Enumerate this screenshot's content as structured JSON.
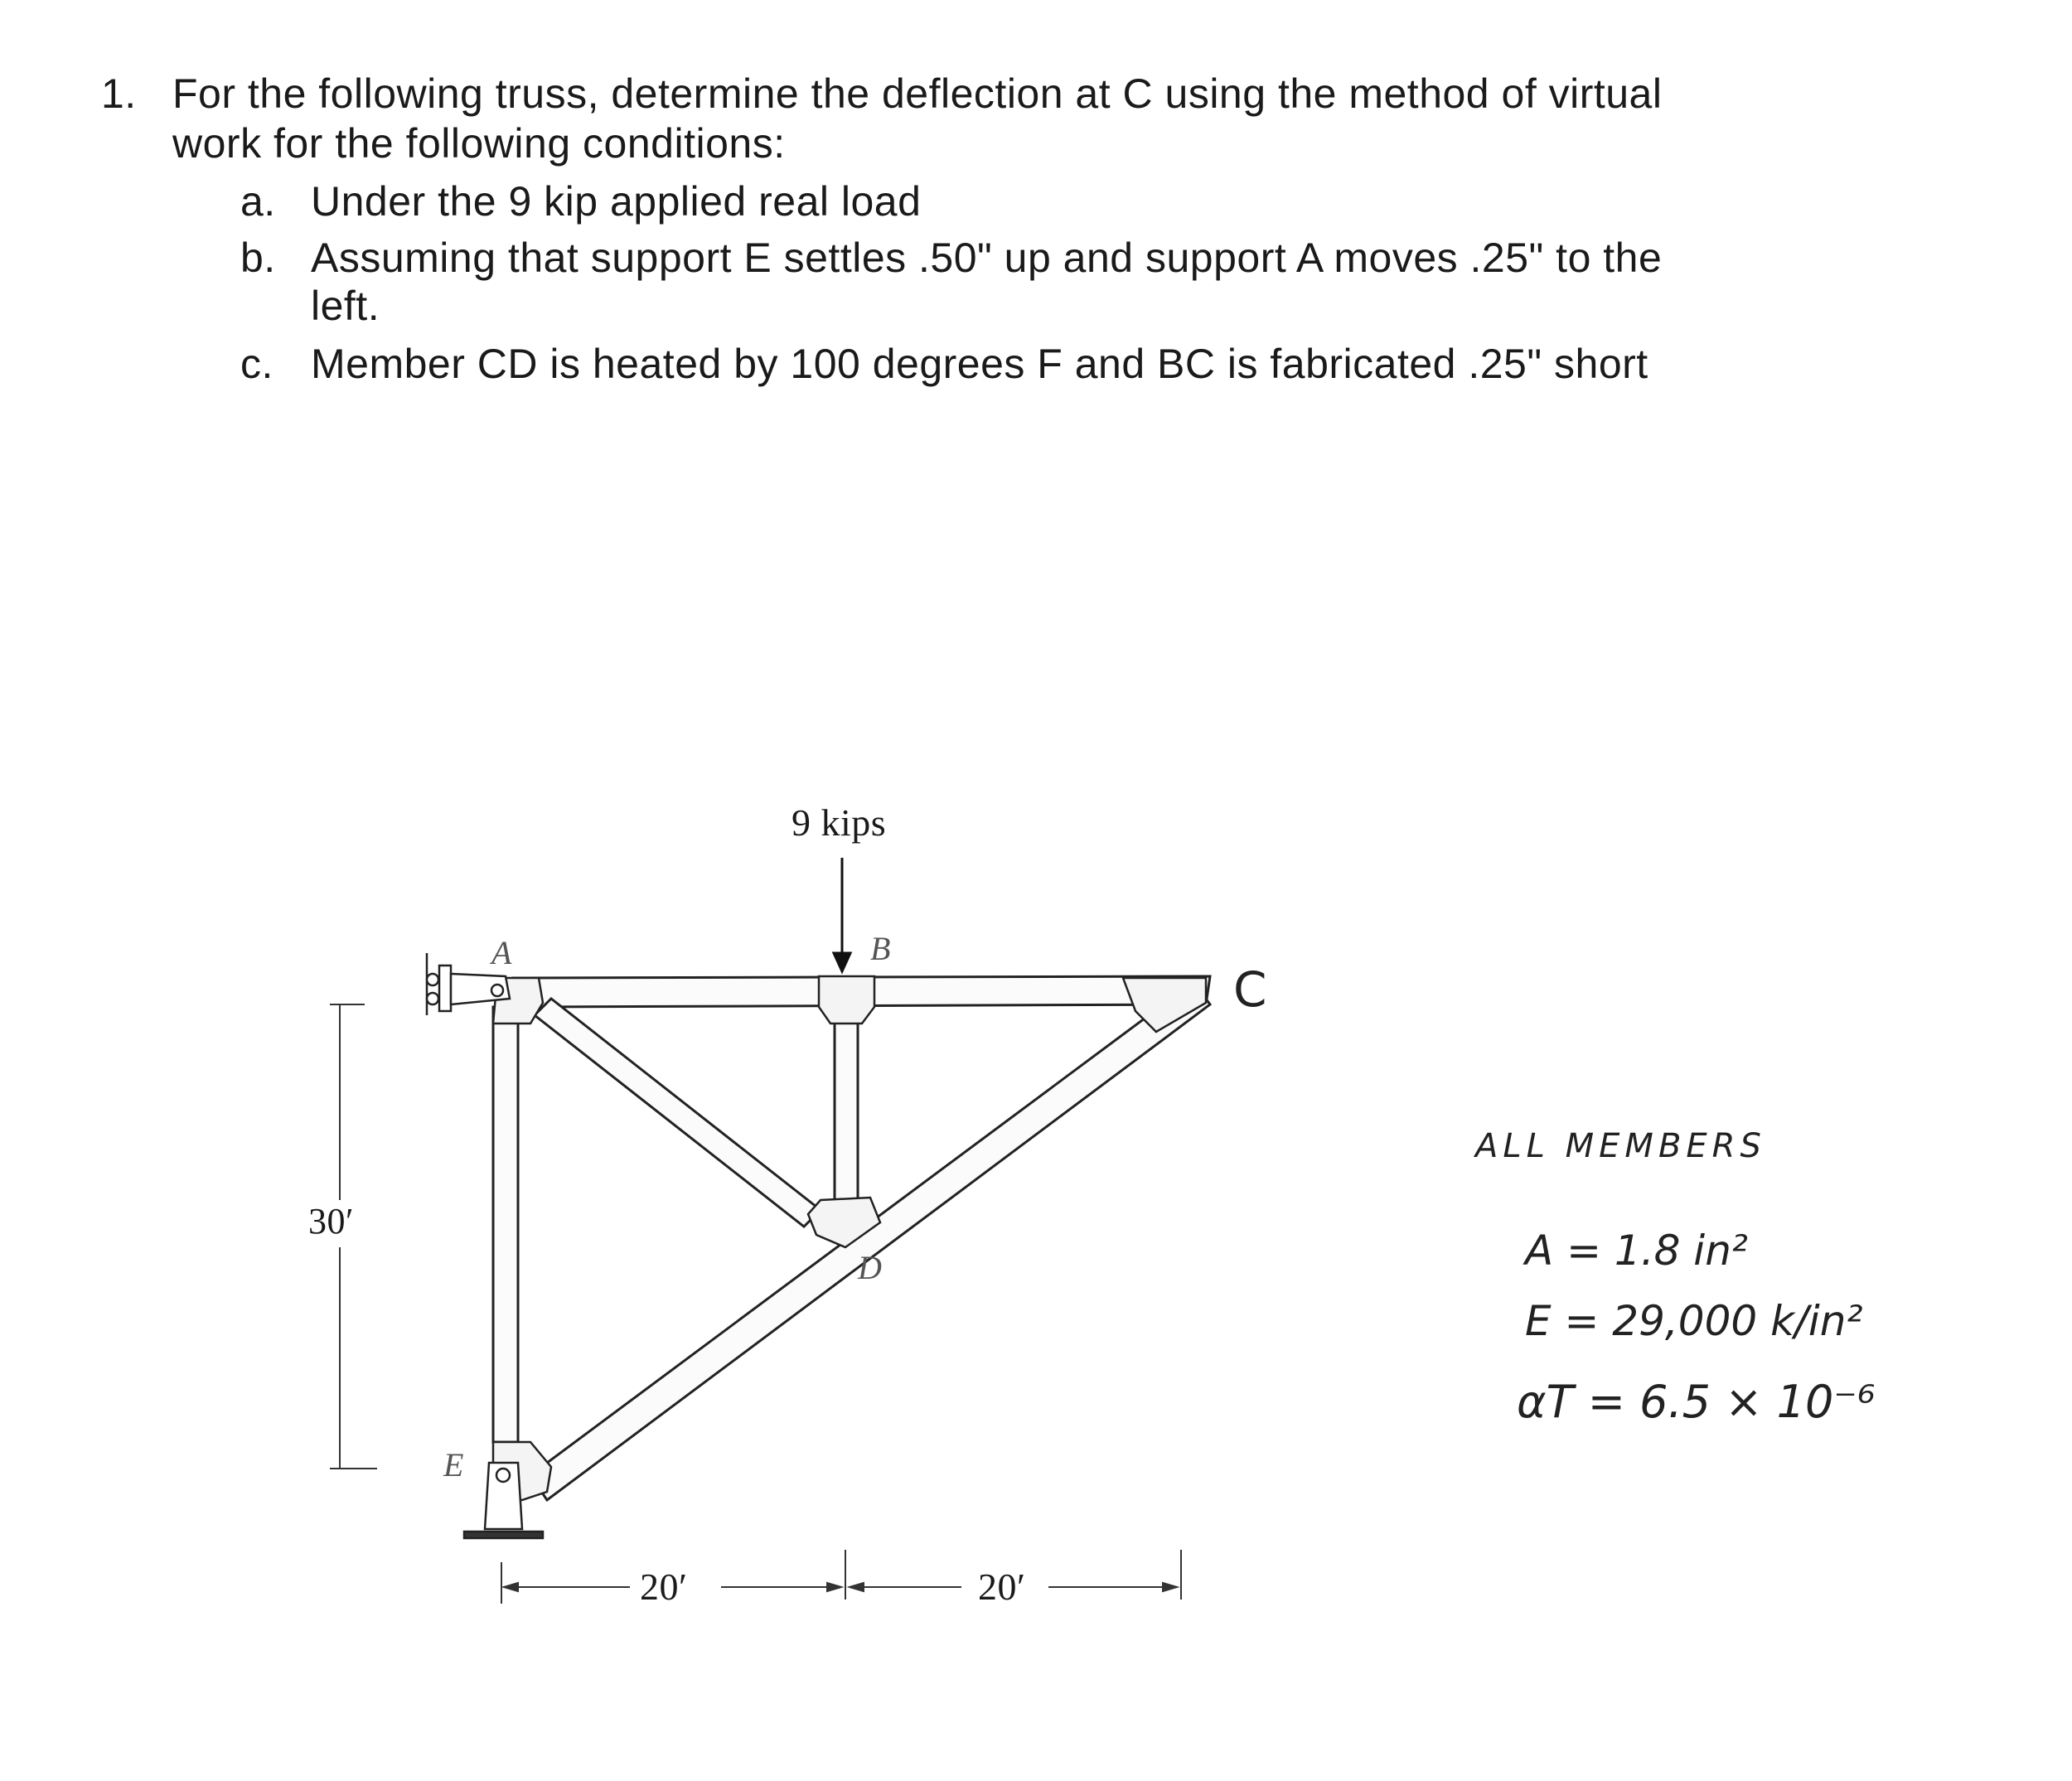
{
  "problem": {
    "number": "1.",
    "intro_line1": "For the following truss, determine the deflection at C using the method of virtual",
    "intro_line2": "work for the following conditions:",
    "items": [
      {
        "marker": "a.",
        "text": "Under the 9 kip applied real load"
      },
      {
        "marker": "b.",
        "text": "Assuming that support E settles .50\" up and support A moves .25\" to the",
        "continuation": "left."
      },
      {
        "marker": "c.",
        "text": "Member CD is heated by 100 degrees F and BC is fabricated .25\" short"
      }
    ]
  },
  "figure": {
    "load_label": "9 kips",
    "joint_labels": {
      "A": "A",
      "B": "B",
      "C": "C",
      "D": "D",
      "E": "E"
    },
    "dimensions": {
      "height": "30′",
      "span_left": "20′",
      "span_right": "20′"
    }
  },
  "notes": {
    "heading": "ALL MEMBERS",
    "area": "A = 1.8 in²",
    "modulus": "E = 29,000 k/in²",
    "thermal_coeff": "αT = 6.5 × 10⁻⁶"
  }
}
